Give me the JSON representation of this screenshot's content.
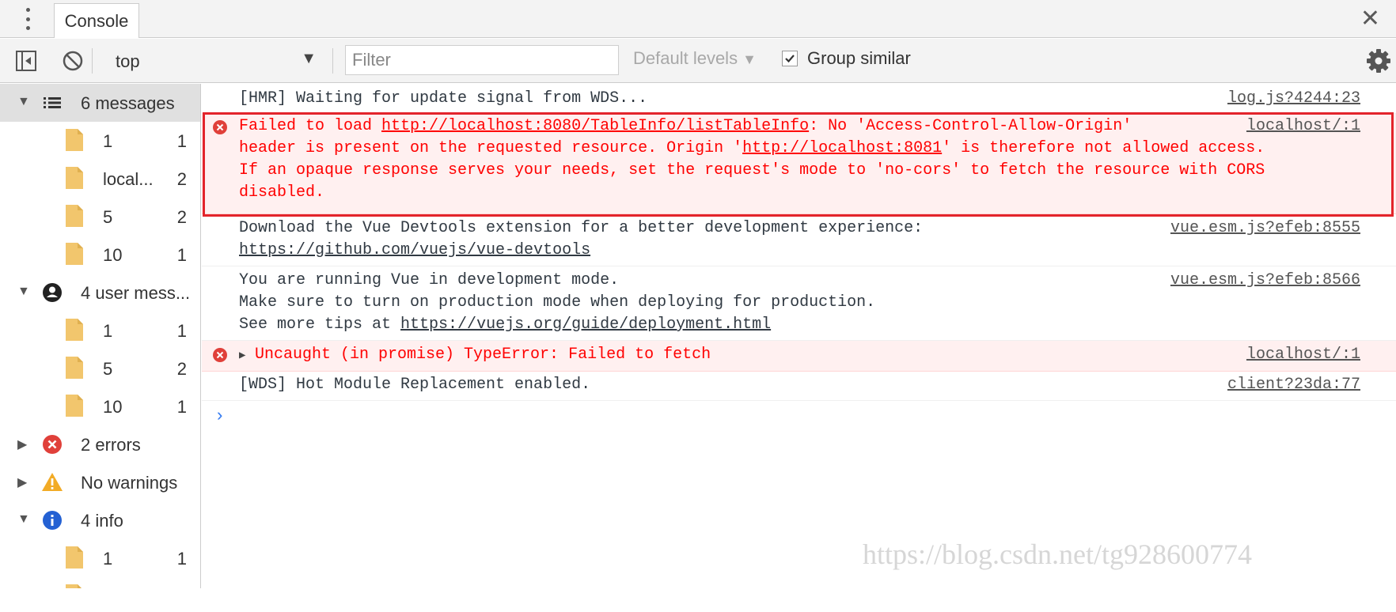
{
  "tabs": {
    "active": "Console"
  },
  "toolbar": {
    "context": "top",
    "filter_placeholder": "Filter",
    "levels": "Default levels",
    "group_similar": "Group similar",
    "group_similar_checked": true
  },
  "sidebar": {
    "all": {
      "label": "6 messages"
    },
    "all_children": [
      {
        "label": "1",
        "count": "1"
      },
      {
        "label": "local...",
        "count": "2"
      },
      {
        "label": "5",
        "count": "2"
      },
      {
        "label": "10",
        "count": "1"
      }
    ],
    "user": {
      "label": "4 user mess..."
    },
    "user_children": [
      {
        "label": "1",
        "count": "1"
      },
      {
        "label": "5",
        "count": "2"
      },
      {
        "label": "10",
        "count": "1"
      }
    ],
    "errors": {
      "label": "2 errors"
    },
    "warnings": {
      "label": "No warnings"
    },
    "info": {
      "label": "4 info"
    },
    "info_children": [
      {
        "label": "1",
        "count": "1"
      }
    ]
  },
  "messages": {
    "hmr": {
      "text": "[HMR] Waiting for update signal from WDS...",
      "source": "log.js?4244:23"
    },
    "cors": {
      "prefix": "Failed to load ",
      "url": "http://localhost:8080/TableInfo/listTableInfo",
      "mid": ": No 'Access-Control-Allow-Origin'",
      "line2_a": "header is present on the requested resource. Origin '",
      "origin": "http://localhost:8081",
      "line2_b": "' is therefore not allowed access.",
      "line3": "If an opaque response serves your needs, set the request's mode to 'no-cors' to fetch the resource with CORS",
      "line4": "disabled.",
      "source": "localhost/:1"
    },
    "devtools": {
      "line1": "Download the Vue Devtools extension for a better development experience:",
      "link": "https://github.com/vuejs/vue-devtools",
      "source": "vue.esm.js?efeb:8555"
    },
    "devmode": {
      "line1": "You are running Vue in development mode.",
      "line2": "Make sure to turn on production mode when deploying for production.",
      "line3_a": "See more tips at ",
      "link": "https://vuejs.org/guide/deployment.html",
      "source": "vue.esm.js?efeb:8566"
    },
    "uncaught": {
      "text": "Uncaught (in promise) TypeError: Failed to fetch",
      "source": "localhost/:1"
    },
    "wds": {
      "text": "[WDS] Hot Module Replacement enabled.",
      "source": "client?23da:77"
    }
  },
  "prompt_symbol": "›",
  "watermark": "https://blog.csdn.net/tg928600774",
  "colors": {
    "error_text": "#ff0000",
    "error_bg": "#fff0f0",
    "highlight": "#e3242b",
    "prompt": "#367cf1"
  }
}
